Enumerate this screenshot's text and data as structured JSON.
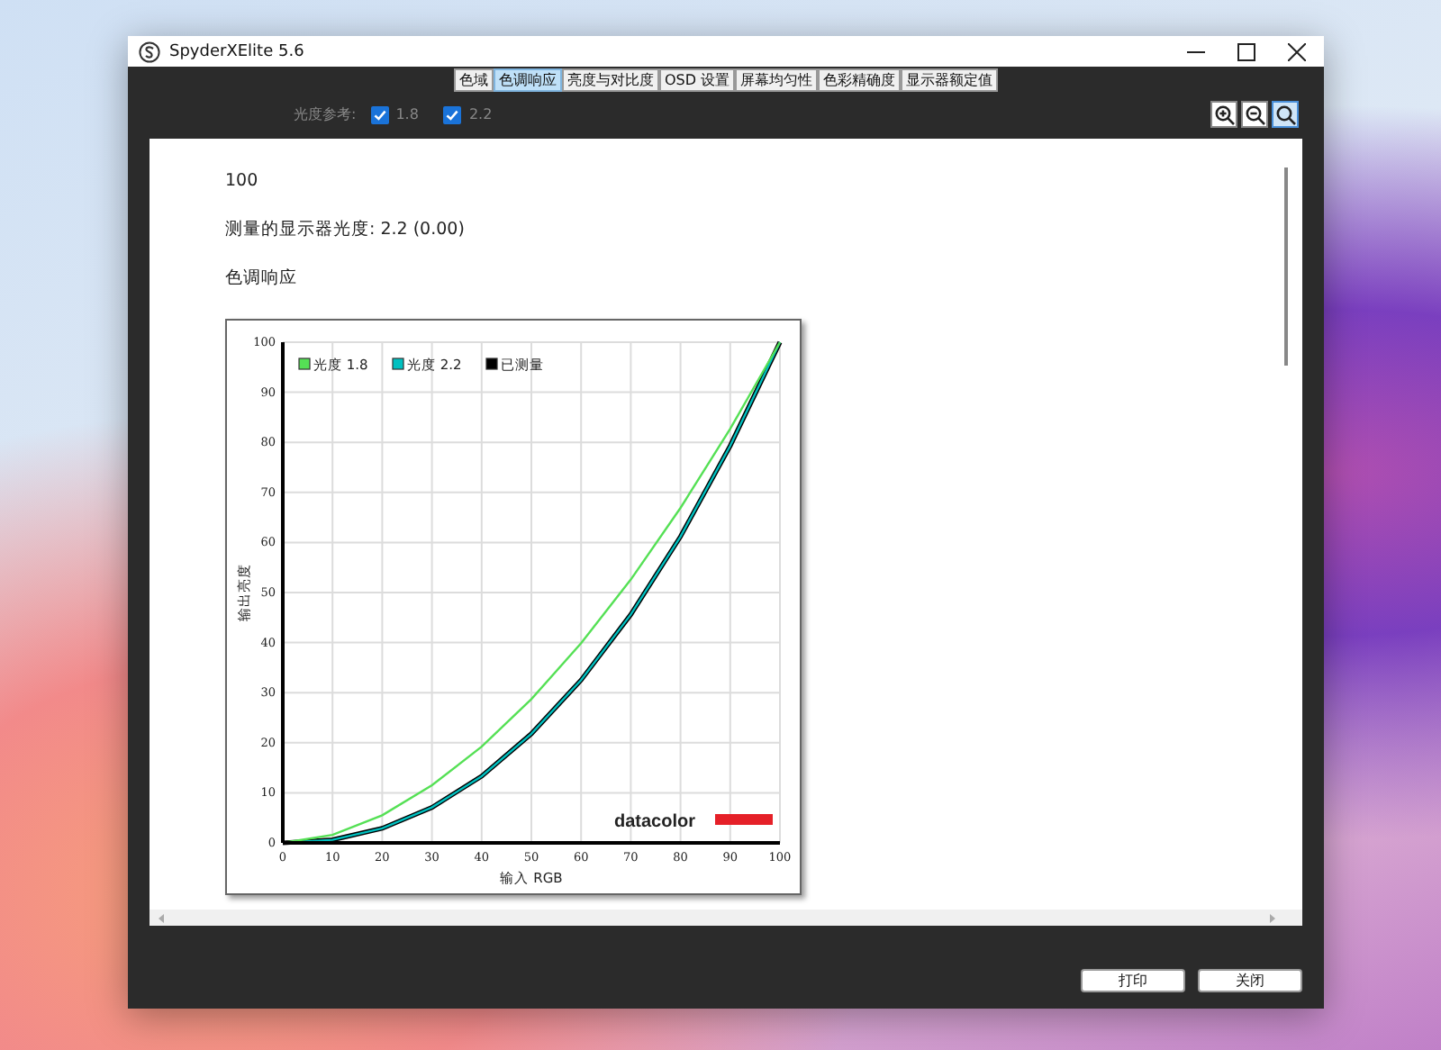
{
  "window": {
    "title": "SpyderXElite 5.6"
  },
  "tabs": [
    {
      "label": "色域",
      "selected": false
    },
    {
      "label": "色调响应",
      "selected": true
    },
    {
      "label": "亮度与对比度",
      "selected": false
    },
    {
      "label": "OSD 设置",
      "selected": false
    },
    {
      "label": "屏幕均匀性",
      "selected": false
    },
    {
      "label": "色彩精确度",
      "selected": false
    },
    {
      "label": "显示器额定值",
      "selected": false
    }
  ],
  "gamma_reference": {
    "label": "光度参考:",
    "options": [
      {
        "label": "1.8",
        "checked": true
      },
      {
        "label": "2.2",
        "checked": true
      }
    ]
  },
  "report": {
    "value": "100",
    "measured_gamma": "测量的显示器光度: 2.2 (0.00)",
    "section_title": "色调响应",
    "chart": {
      "logo_text": "datacolor",
      "chart_data": {
        "type": "line",
        "xlabel": "输入 RGB",
        "ylabel": "输出亮度",
        "x": [
          0,
          10,
          20,
          30,
          40,
          50,
          60,
          70,
          80,
          90,
          100
        ],
        "series": [
          {
            "name": "光度 1.8",
            "color": "#55e055",
            "values": [
              0,
              1.6,
              5.5,
              11.5,
              19.2,
              28.7,
              39.9,
              52.6,
              66.9,
              82.7,
              100
            ]
          },
          {
            "name": "光度 2.2",
            "color": "#00c0c0",
            "values": [
              0,
              0.6,
              2.9,
              7.1,
              13.3,
              21.8,
              32.5,
              45.6,
              61.2,
              79.3,
              100
            ]
          },
          {
            "name": "已测量",
            "color": "#000000",
            "values": [
              0,
              0.6,
              2.9,
              7.1,
              13.3,
              21.8,
              32.5,
              45.6,
              61.2,
              79.3,
              100
            ]
          }
        ],
        "grid": true,
        "legend": true,
        "xlim": [
          0,
          100
        ],
        "ylim": [
          0,
          100
        ],
        "xticks": [
          0,
          10,
          20,
          30,
          40,
          50,
          60,
          70,
          80,
          90,
          100
        ],
        "yticks": [
          0,
          10,
          20,
          30,
          40,
          50,
          60,
          70,
          80,
          90,
          100
        ]
      }
    }
  },
  "buttons": [
    "打印",
    "关闭"
  ]
}
